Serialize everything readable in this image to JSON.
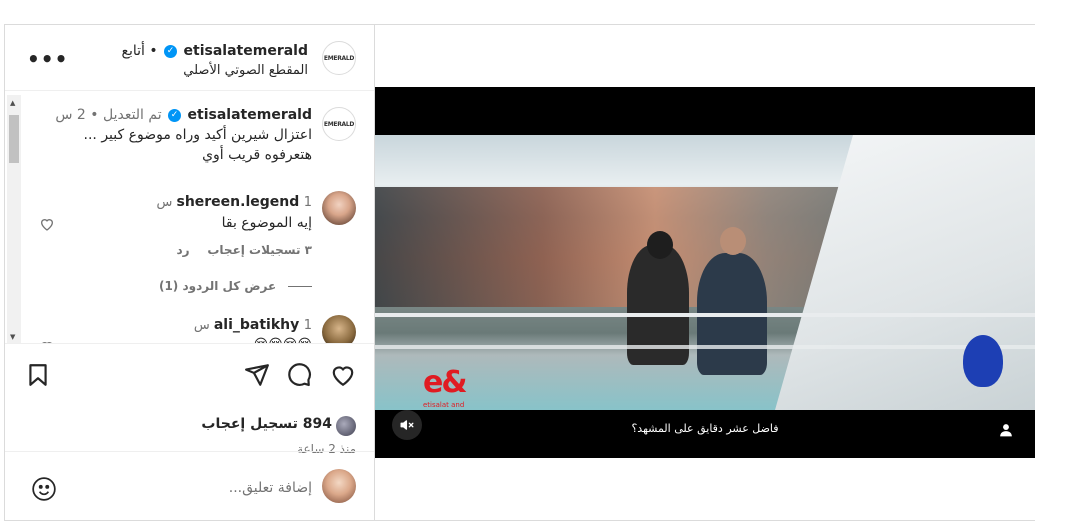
{
  "header": {
    "username": "etisalatemerald",
    "separator": "•",
    "follow_label": "أتابع",
    "audio_label": "المقطع الصوتي الأصلي",
    "avatar_text": "EMERALD",
    "more_icon": "more-horizontal-icon"
  },
  "caption": {
    "username": "etisalatemerald",
    "edited_label": "تم التعديل",
    "separator": "•",
    "time": "2 س",
    "line1": "اعتزال شيرين أكيد وراه موضوع كبير ...",
    "line2": "هتعرفوه قريب أوي",
    "avatar_text": "EMERALD"
  },
  "comments": [
    {
      "username": "shereen.legend",
      "time": "1 س",
      "text": "إيه الموضوع بقا",
      "likes_label": "٣ تسجيلات إعجاب",
      "reply_label": "رد",
      "view_replies": "عرض كل الردود (1)"
    },
    {
      "username": "ali_batikhy",
      "time": "1 س",
      "text": "😢😢😢😢"
    }
  ],
  "actions": {
    "likes_count": "894",
    "likes_label": "تسجيل إعجاب",
    "time_ago": "منذ 2 ساعة"
  },
  "add_comment": {
    "placeholder": "إضافة تعليق..."
  },
  "video": {
    "subtitle": "فاضل عشر دقايق على المشهد؟",
    "brand_mark": "e&",
    "brand_sub": "etisalat and"
  },
  "colors": {
    "verified": "#0095f6",
    "brand_red": "#e01b22",
    "muted_text": "#737373"
  }
}
